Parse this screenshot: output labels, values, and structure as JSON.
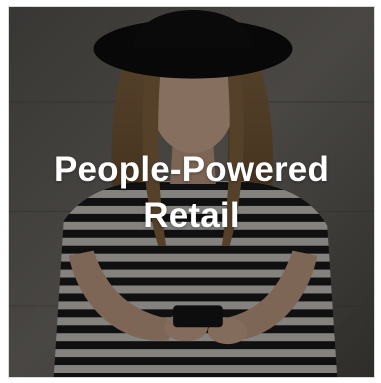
{
  "tile": {
    "headline_line1": "People-Powered",
    "headline_line2": "Retail",
    "image_icon": "photo-woman-with-phone",
    "colors": {
      "text": "#ffffff",
      "wall": "#6f6b66",
      "hat": "#111111",
      "stripes_dark": "#1a1a1a",
      "stripes_light": "#d8d6d2"
    }
  }
}
